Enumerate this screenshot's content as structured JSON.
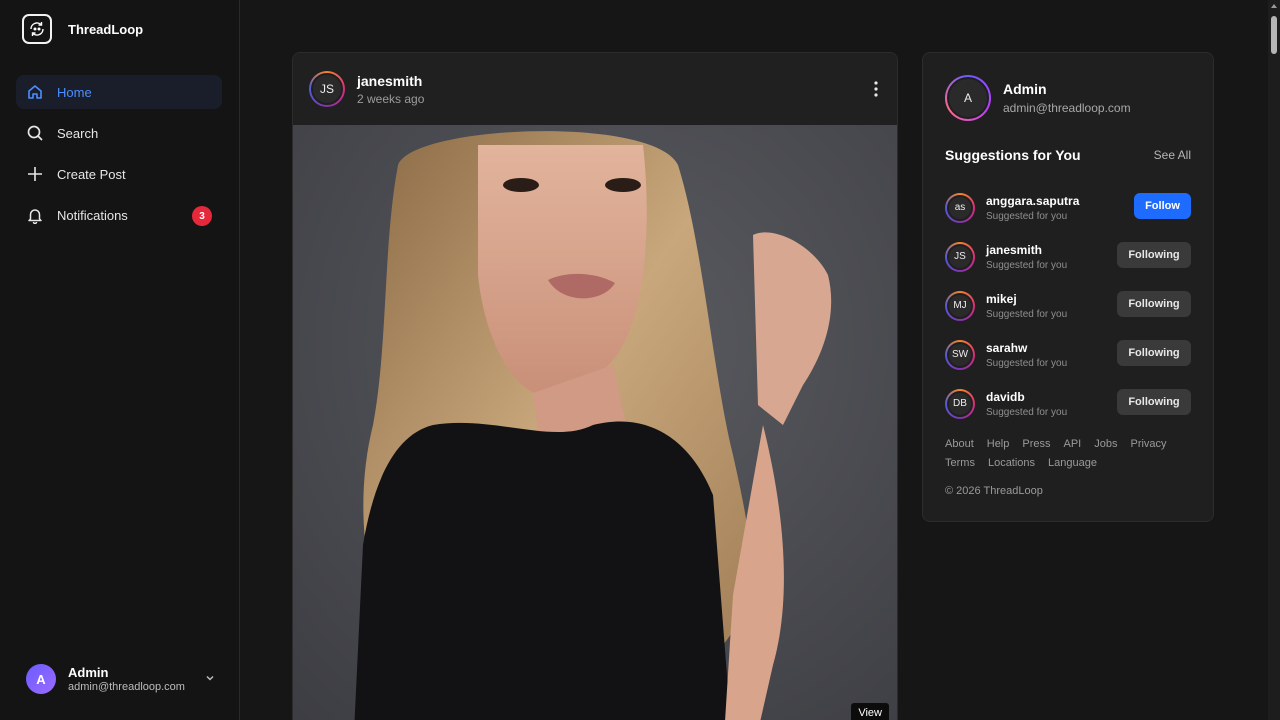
{
  "app": {
    "name": "ThreadLoop"
  },
  "sidebar": {
    "items": [
      {
        "label": "Home",
        "icon": "home-icon"
      },
      {
        "label": "Search",
        "icon": "search-icon"
      },
      {
        "label": "Create Post",
        "icon": "plus-icon"
      },
      {
        "label": "Notifications",
        "icon": "bell-icon",
        "badge": "3"
      }
    ],
    "user": {
      "initial": "A",
      "name": "Admin",
      "email": "admin@threadloop.com"
    }
  },
  "post": {
    "initials": "JS",
    "username": "janesmith",
    "time": "2 weeks ago",
    "view_label": "View"
  },
  "panel": {
    "me": {
      "initial": "A",
      "name": "Admin",
      "email": "admin@threadloop.com"
    },
    "title": "Suggestions for You",
    "see_all": "See All",
    "suggestions": [
      {
        "initials": "as",
        "name": "anggara.saputra",
        "sub": "Suggested for you",
        "button": "Follow"
      },
      {
        "initials": "JS",
        "name": "janesmith",
        "sub": "Suggested for you",
        "button": "Following"
      },
      {
        "initials": "MJ",
        "name": "mikej",
        "sub": "Suggested for you",
        "button": "Following"
      },
      {
        "initials": "SW",
        "name": "sarahw",
        "sub": "Suggested for you",
        "button": "Following"
      },
      {
        "initials": "DB",
        "name": "davidb",
        "sub": "Suggested for you",
        "button": "Following"
      }
    ],
    "footer_links": [
      "About",
      "Help",
      "Press",
      "API",
      "Jobs",
      "Privacy",
      "Terms",
      "Locations",
      "Language"
    ],
    "copyright": "© 2026 ThreadLoop"
  },
  "colors": {
    "accent": "#4d8eff",
    "follow": "#1e6bff",
    "badge": "#e5283a"
  }
}
